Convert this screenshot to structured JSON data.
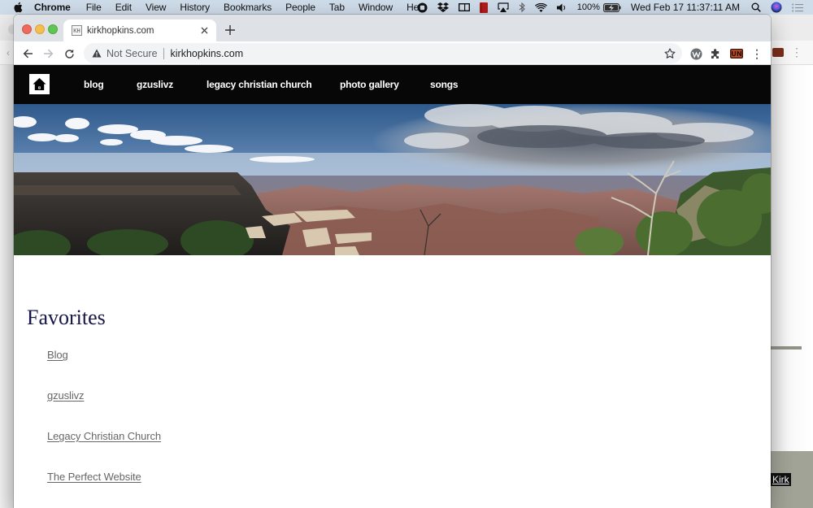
{
  "menubar": {
    "app_name": "Chrome",
    "menus": [
      "File",
      "Edit",
      "View",
      "History",
      "Bookmarks",
      "People",
      "Tab",
      "Window",
      "Help"
    ],
    "status_icons": [
      "screen-record-icon",
      "dropbox-icon",
      "display-icon",
      "book-icon",
      "airplay-icon",
      "bluetooth-icon",
      "wifi-icon",
      "volume-icon"
    ],
    "battery_percent": "100%",
    "clock": "Wed Feb 17  11:37:11 AM"
  },
  "browser": {
    "tab_title": "kirkhopkins.com",
    "favicon_text": "KH",
    "security_label": "Not Secure",
    "url": "kirkhopkins.com"
  },
  "site": {
    "nav": [
      {
        "label": "blog"
      },
      {
        "label": "gzuslivz"
      },
      {
        "label": "legacy christian church"
      },
      {
        "label": "photo gallery"
      },
      {
        "label": "songs"
      }
    ],
    "hero_alt": "Grand Canyon panorama",
    "favorites_title": "Favorites",
    "favorites": [
      {
        "label": "Blog"
      },
      {
        "label": "gzuslivz"
      },
      {
        "label": "Legacy Christian Church"
      },
      {
        "label": "The Perfect Website"
      }
    ]
  },
  "background_window": {
    "visible_link": "Kirk"
  },
  "colors": {
    "nav_bg": "#070707",
    "heading": "#141648",
    "link": "#666666"
  }
}
